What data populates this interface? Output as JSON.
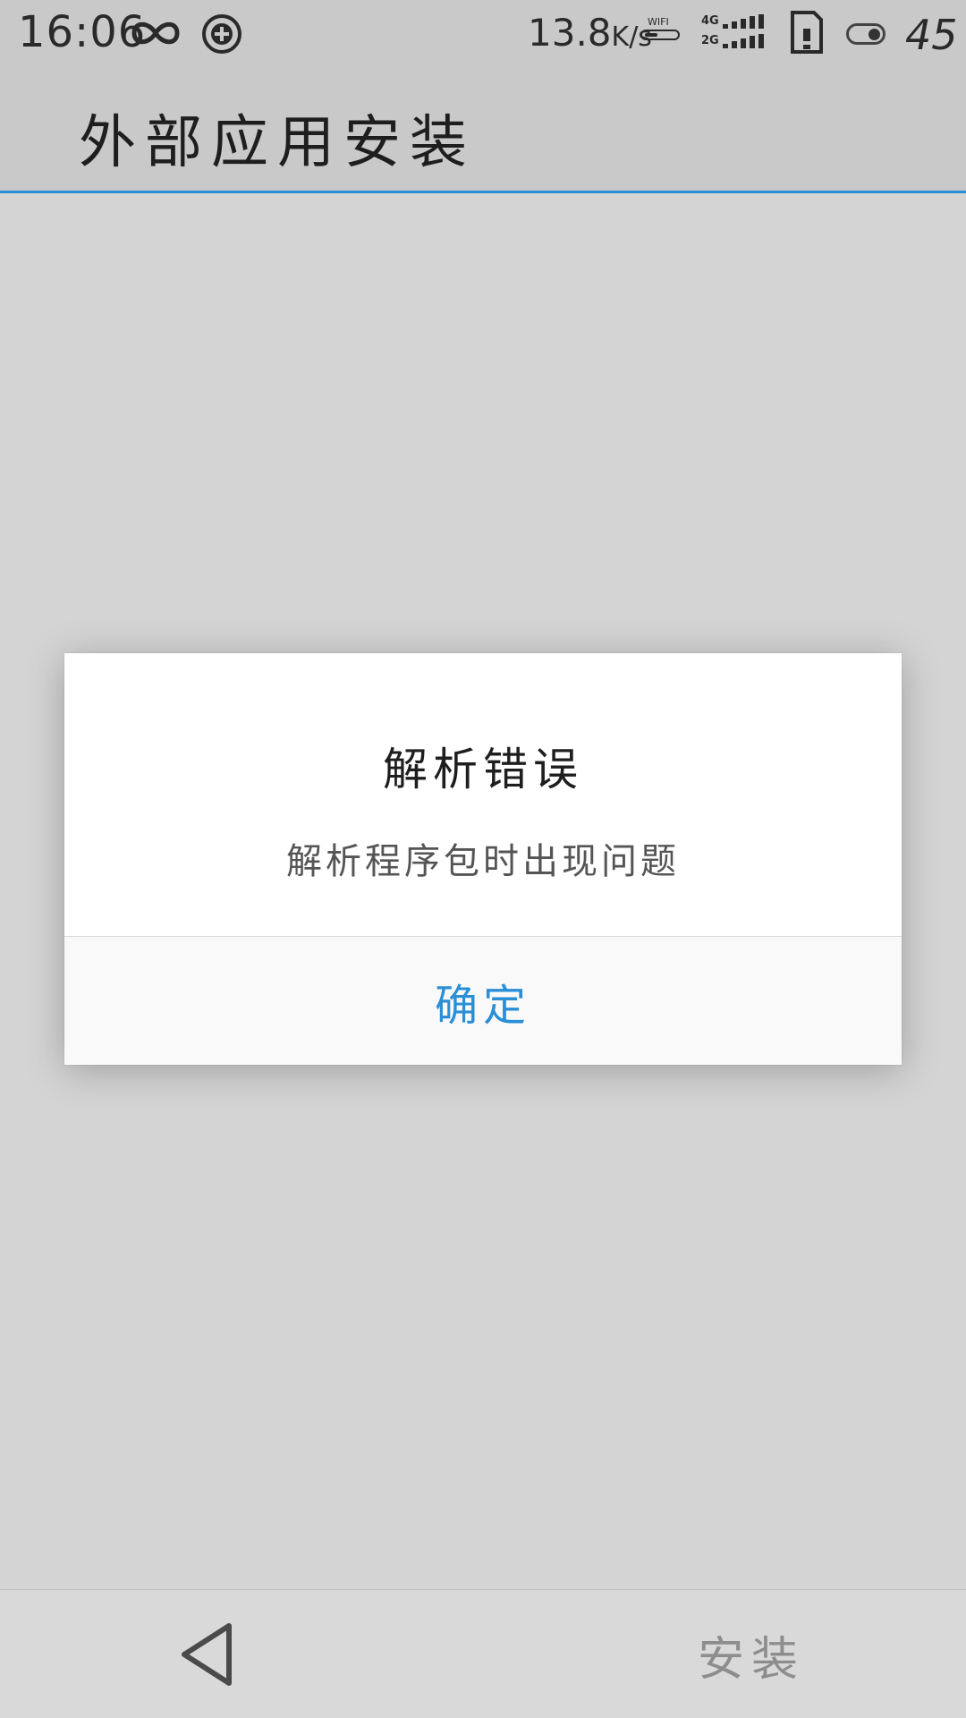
{
  "status_bar": {
    "time": "16:06",
    "net_speed_value": "13.8",
    "net_speed_unit": "K/s",
    "wifi_label": "WIFI",
    "network_1": "4G",
    "network_2": "2G",
    "battery": "45",
    "icons": {
      "infinity": "infinity-icon",
      "vpn": "vpn-plus-icon",
      "wifi": "wifi-icon",
      "signal": "cell-signal-icon",
      "sim": "sim-card-icon",
      "toggle": "toggle-icon"
    }
  },
  "app_bar": {
    "title": "外部应用安装"
  },
  "dialog": {
    "title": "解析错误",
    "message": "解析程序包时出现问题",
    "confirm_label": "确定"
  },
  "bottom_bar": {
    "back_icon": "back-triangle-icon",
    "install_label": "安装"
  },
  "colors": {
    "accent": "#2a8fd6",
    "background": "#d4d4d4",
    "app_bar": "#c9c9c9",
    "dialog": "#ffffff"
  }
}
